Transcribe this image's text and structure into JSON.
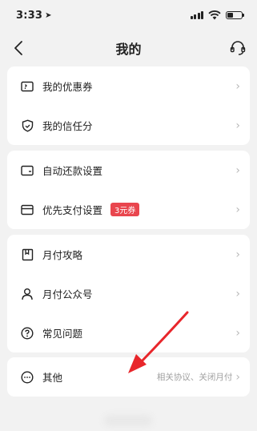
{
  "status_bar": {
    "time": "3:33",
    "location_glyph": "➤",
    "battery_level": 0.4
  },
  "nav": {
    "title": "我的",
    "back_icon": "chevron-left-icon",
    "service_icon": "headset-icon"
  },
  "sections": [
    {
      "items": [
        {
          "label": "我的优惠券",
          "icon": "coupon-icon"
        },
        {
          "label": "我的信任分",
          "icon": "shield-icon"
        }
      ]
    },
    {
      "items": [
        {
          "label": "自动还款设置",
          "icon": "wallet-icon"
        },
        {
          "label": "优先支付设置",
          "icon": "card-icon",
          "badge": "3元券"
        }
      ]
    },
    {
      "items": [
        {
          "label": "月付攻略",
          "icon": "bookmark-icon"
        },
        {
          "label": "月付公众号",
          "icon": "person-icon"
        },
        {
          "label": "常见问题",
          "icon": "question-icon"
        }
      ]
    },
    {
      "items": [
        {
          "label": "其他",
          "icon": "more-icon",
          "subtext": "相关协议、关闭月付"
        }
      ]
    }
  ],
  "chevron": "›",
  "colors": {
    "background": "#f2f2f2",
    "card": "#ffffff",
    "badge": "#e9464e",
    "annotation_arrow": "#e8262b"
  }
}
